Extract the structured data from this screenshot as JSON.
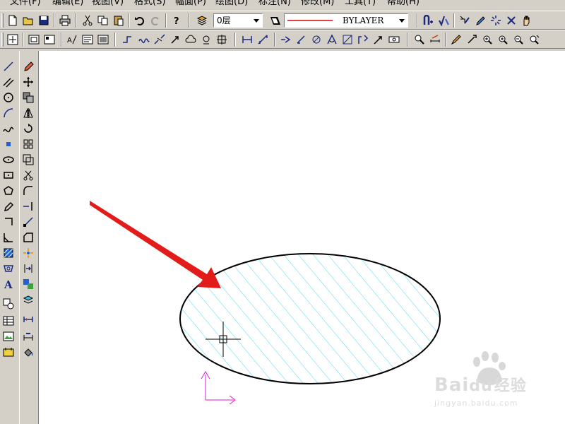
{
  "menu": [
    "文件(F)",
    "编辑(E)",
    "视图(V)",
    "格式(S)",
    "幅面(P)",
    "绘图(D)",
    "标注(N)",
    "修改(M)",
    "工具(T)",
    "帮助(H)"
  ],
  "layer_combo": {
    "value": "0层"
  },
  "linetype_combo": {
    "value": "BYLAYER"
  },
  "colors": {
    "hatch": "#4dd9f0",
    "arrow": "#e21b1b",
    "ucs": "#d81bd8",
    "line_red": "#e00000",
    "canvas": "#ffffff"
  },
  "watermark": {
    "brand": "Bai",
    "du": "du",
    "cn": "经验",
    "url": "jingyan.baidu.com"
  },
  "toolbar1_icons": [
    "new-file-icon",
    "open-folder-icon",
    "save-icon",
    "print-icon",
    "cut-icon",
    "copy-icon",
    "paste-icon",
    "undo-icon",
    "redo-icon",
    "help-icon",
    "layer-manager-icon"
  ],
  "toolbar2_icons": [
    "zoom-extents-icon",
    "zoom-window-icon",
    "zoom-all-icon",
    "text-style-icon",
    "text-edit-icon",
    "block-insert-icon",
    "polyline-icon",
    "spline-icon",
    "break-icon",
    "cloud-icon",
    "region-icon",
    "dimension-linear-icon",
    "dimension-aligned-icon"
  ]
}
